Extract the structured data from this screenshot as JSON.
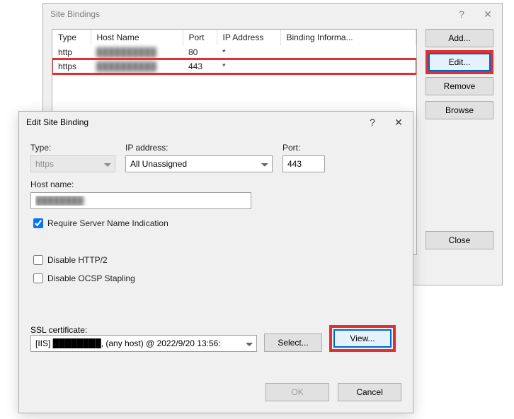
{
  "siteBindings": {
    "title": "Site Bindings",
    "columns": {
      "type": "Type",
      "hostName": "Host Name",
      "port": "Port",
      "ip": "IP Address",
      "info": "Binding Informa..."
    },
    "rows": [
      {
        "type": "http",
        "hostName": "██████████",
        "port": "80",
        "ip": "*",
        "info": ""
      },
      {
        "type": "https",
        "hostName": "██████████",
        "port": "443",
        "ip": "*",
        "info": ""
      }
    ],
    "buttons": {
      "add": "Add...",
      "edit": "Edit...",
      "remove": "Remove",
      "browse": "Browse",
      "close": "Close"
    }
  },
  "editBinding": {
    "title": "Edit Site Binding",
    "labels": {
      "type": "Type:",
      "ip": "IP address:",
      "port": "Port:",
      "hostName": "Host name:",
      "sni": "Require Server Name Indication",
      "disableHttp2": "Disable HTTP/2",
      "disableOcsp": "Disable OCSP Stapling",
      "sslCert": "SSL certificate:"
    },
    "values": {
      "type": "https",
      "ip": "All Unassigned",
      "port": "443",
      "hostName": "████████",
      "sslCert": "[IIS] ████████, (any host) @ 2022/9/20 13:56:"
    },
    "buttons": {
      "select": "Select...",
      "view": "View...",
      "ok": "OK",
      "cancel": "Cancel"
    }
  }
}
